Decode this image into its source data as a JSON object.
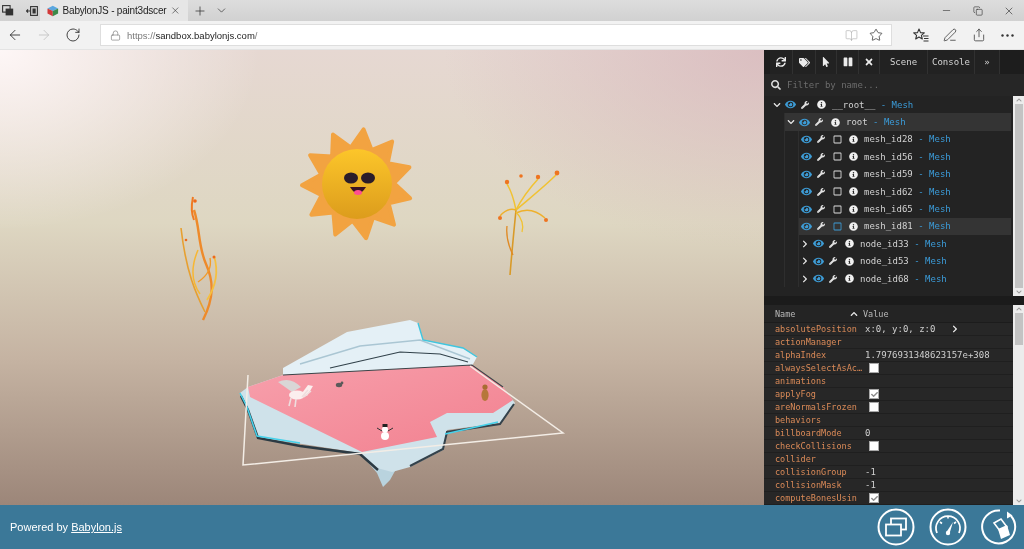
{
  "browser": {
    "tabs": [
      {
        "title": "BabylonJS - paint3dscer",
        "selected": true
      }
    ],
    "navigation": [
      {
        "kind": "back",
        "disabled": false
      },
      {
        "kind": "forward",
        "disabled": true
      },
      {
        "kind": "refresh",
        "disabled": false
      }
    ],
    "address": {
      "scheme": "https://",
      "host": "sandbox.babylonjs.com",
      "path": "/"
    }
  },
  "inspector": {
    "toolbar": {
      "tabs": [
        "Scene",
        "Console"
      ],
      "more": "»"
    },
    "filter": {
      "placeholder": "Filter by name..."
    },
    "tree": [
      {
        "name": "__root__",
        "suffix": "- Mesh",
        "kind": "group",
        "expanded": true,
        "visible": true,
        "selected": false,
        "children": [
          {
            "name": "root",
            "suffix": "- Mesh",
            "kind": "group",
            "expanded": true,
            "visible": true,
            "selected": true,
            "children": [
              {
                "name": "mesh_id28",
                "suffix": "- Mesh",
                "kind": "leaf",
                "visible": true,
                "checked": false,
                "selected": false
              },
              {
                "name": "mesh_id56",
                "suffix": "- Mesh",
                "kind": "leaf",
                "visible": true,
                "checked": false,
                "selected": false
              },
              {
                "name": "mesh_id59",
                "suffix": "- Mesh",
                "kind": "leaf",
                "visible": true,
                "checked": false,
                "selected": false
              },
              {
                "name": "mesh_id62",
                "suffix": "- Mesh",
                "kind": "leaf",
                "visible": true,
                "checked": false,
                "selected": false
              },
              {
                "name": "mesh_id65",
                "suffix": "- Mesh",
                "kind": "leaf",
                "visible": true,
                "checked": false,
                "selected": false
              },
              {
                "name": "mesh_id81",
                "suffix": "- Mesh",
                "kind": "leaf",
                "visible": true,
                "checked": false,
                "selected": true
              },
              {
                "name": "node_id33",
                "suffix": "- Mesh",
                "kind": "group",
                "expanded": false,
                "visible": true,
                "selected": false
              },
              {
                "name": "node_id53",
                "suffix": "- Mesh",
                "kind": "group",
                "expanded": false,
                "visible": true,
                "selected": false
              },
              {
                "name": "node_id68",
                "suffix": "- Mesh",
                "kind": "group",
                "expanded": false,
                "visible": true,
                "selected": false
              }
            ]
          }
        ]
      }
    ],
    "properties": {
      "columns": [
        {
          "label": "Name",
          "sorted": true
        },
        {
          "label": "Value",
          "sorted": false
        }
      ],
      "rows": [
        {
          "name": "absolutePosition",
          "kind": "vector",
          "value": "x:0, y:0, z:0"
        },
        {
          "name": "actionManager",
          "kind": "object"
        },
        {
          "name": "alphaIndex",
          "kind": "value",
          "value": "1.7976931348623157e+308"
        },
        {
          "name": "alwaysSelectAsAc…",
          "kind": "checkbox",
          "checked": false
        },
        {
          "name": "animations",
          "kind": "object"
        },
        {
          "name": "applyFog",
          "kind": "checkbox",
          "checked": true
        },
        {
          "name": "areNormalsFrozen",
          "kind": "checkbox",
          "checked": false
        },
        {
          "name": "behaviors",
          "kind": "object"
        },
        {
          "name": "billboardMode",
          "kind": "value",
          "value": "0"
        },
        {
          "name": "checkCollisions",
          "kind": "checkbox",
          "checked": false
        },
        {
          "name": "collider",
          "kind": "object"
        },
        {
          "name": "collisionGroup",
          "kind": "value",
          "value": "-1"
        },
        {
          "name": "collisionMask",
          "kind": "value",
          "value": "-1"
        },
        {
          "name": "computeBonesUsin",
          "kind": "checkbox",
          "checked": true
        }
      ]
    }
  },
  "footer": {
    "text": "Powered by",
    "link": "Babylon.js"
  }
}
